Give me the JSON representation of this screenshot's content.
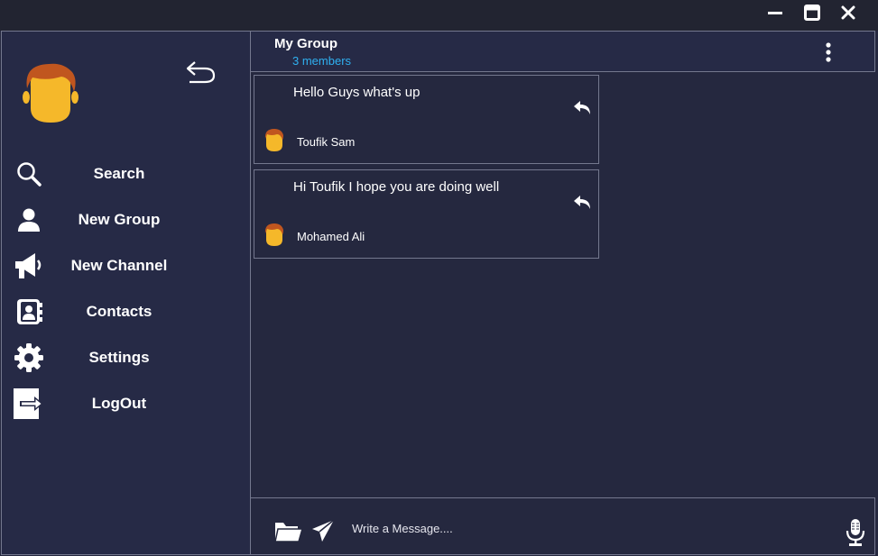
{
  "titlebar": {
    "buttons": [
      "minimize-icon",
      "maximize-icon",
      "close-icon"
    ]
  },
  "sidebar": {
    "back_icon": "undo-arrow-icon",
    "menu": [
      {
        "label": "Search",
        "icon": "search-icon"
      },
      {
        "label": "New Group",
        "icon": "user-icon"
      },
      {
        "label": "New Channel",
        "icon": "megaphone-icon"
      },
      {
        "label": "Contacts",
        "icon": "contact-book-icon"
      },
      {
        "label": "Settings",
        "icon": "gear-icon"
      },
      {
        "label": "LogOut",
        "icon": "logout-icon"
      }
    ]
  },
  "chat": {
    "title": "My Group",
    "subtitle": "3 members",
    "messages": [
      {
        "text": "Hello Guys what's up",
        "sender": "Toufik Sam"
      },
      {
        "text": "Hi Toufik I hope you are doing well",
        "sender": "Mohamed Ali"
      }
    ]
  },
  "composer": {
    "placeholder": "Write a Message....",
    "value": ""
  },
  "colors": {
    "background": "#25283f",
    "titlebar": "#222431",
    "border": "#74788e",
    "accent": "#2fb0f0",
    "avatar_skin": "#f5b82a",
    "avatar_hair": "#c0561f"
  }
}
